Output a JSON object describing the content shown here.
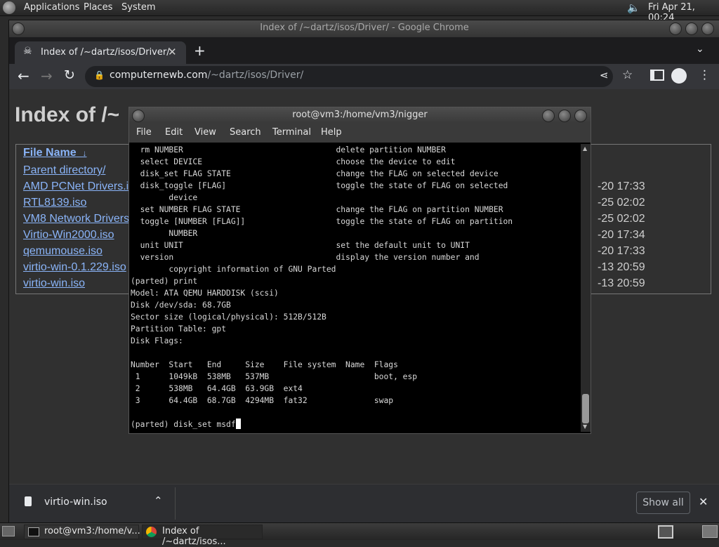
{
  "top_panel": {
    "menus": [
      "Applications",
      "Places",
      "System"
    ],
    "clock": "Fri Apr 21, 00:24"
  },
  "chrome": {
    "window_title": "Index of /~dartz/isos/Driver/ - Google Chrome",
    "tab_title": "Index of /~dartz/isos/Driver/",
    "url_host": "computernewb.com",
    "url_path": "/~dartz/isos/Driver/"
  },
  "page": {
    "heading": "Index of /~",
    "column_file_name": "File Name",
    "sort_arrow": "↓",
    "rows": [
      {
        "name": "Parent directory/",
        "date": ""
      },
      {
        "name": "AMD PCNet Drivers.i",
        "date": "-20 17:33"
      },
      {
        "name": "RTL8139.iso",
        "date": "-25 02:02"
      },
      {
        "name": "VM8 Network Drivers",
        "date": "-25 02:02"
      },
      {
        "name": "Virtio-Win2000.iso",
        "date": "-20 17:34"
      },
      {
        "name": "qemumouse.iso",
        "date": "-20 17:33"
      },
      {
        "name": "virtio-win-0.1.229.iso",
        "date": "-13 20:59"
      },
      {
        "name": "virtio-win.iso",
        "date": "-13 20:59"
      }
    ]
  },
  "download_bar": {
    "file": "virtio-win.iso",
    "show_all": "Show all"
  },
  "terminal": {
    "title": "root@vm3:/home/vm3/nigger",
    "menus": [
      "File",
      "Edit",
      "View",
      "Search",
      "Terminal",
      "Help"
    ],
    "lines": [
      "  rm NUMBER                                delete partition NUMBER",
      "  select DEVICE                            choose the device to edit",
      "  disk_set FLAG STATE                      change the FLAG on selected device",
      "  disk_toggle [FLAG]                       toggle the state of FLAG on selected",
      "        device",
      "  set NUMBER FLAG STATE                    change the FLAG on partition NUMBER",
      "  toggle [NUMBER [FLAG]]                   toggle the state of FLAG on partition",
      "        NUMBER",
      "  unit UNIT                                set the default unit to UNIT",
      "  version                                  display the version number and",
      "        copyright information of GNU Parted",
      "(parted) print",
      "Model: ATA QEMU HARDDISK (scsi)",
      "Disk /dev/sda: 68.7GB",
      "Sector size (logical/physical): 512B/512B",
      "Partition Table: gpt",
      "Disk Flags:",
      "",
      "Number  Start   End     Size    File system  Name  Flags",
      " 1      1049kB  538MB   537MB                      boot, esp",
      " 2      538MB   64.4GB  63.9GB  ext4",
      " 3      64.4GB  68.7GB  4294MB  fat32              swap",
      ""
    ],
    "prompt_line": "(parted) disk_set msdf"
  },
  "taskbar": {
    "items": [
      "root@vm3:/home/v...",
      "Index of /~dartz/isos..."
    ]
  }
}
